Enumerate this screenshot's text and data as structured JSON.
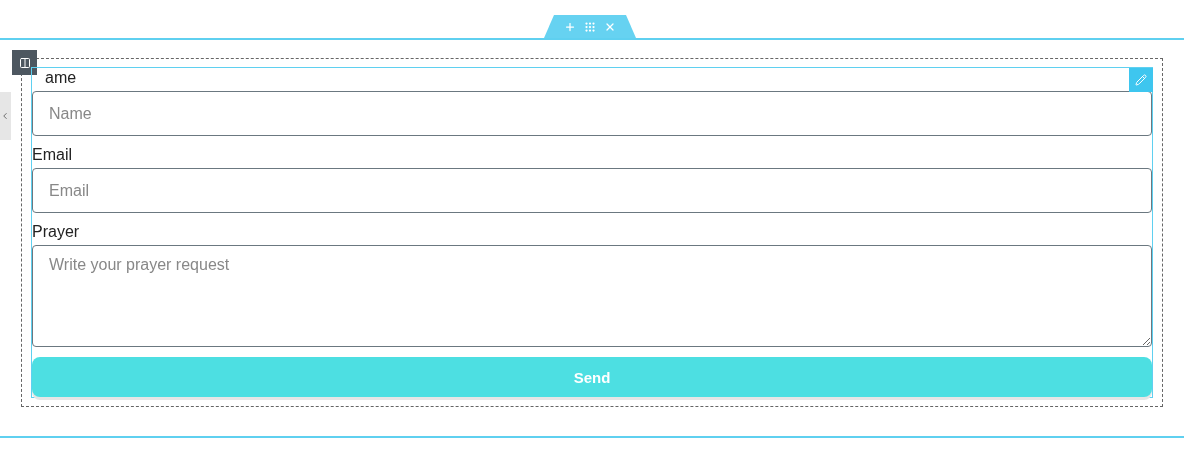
{
  "section_toolbar": {
    "buttons": [
      {
        "kind": "add"
      },
      {
        "kind": "drag"
      },
      {
        "kind": "close"
      }
    ]
  },
  "form": {
    "fields": [
      {
        "kind": "input",
        "label": "ame",
        "placeholder": "Name"
      },
      {
        "kind": "input",
        "label": "Email",
        "placeholder": "Email"
      },
      {
        "kind": "textarea",
        "label": "Prayer",
        "placeholder": "Write your prayer request"
      }
    ],
    "submit": "Send"
  }
}
